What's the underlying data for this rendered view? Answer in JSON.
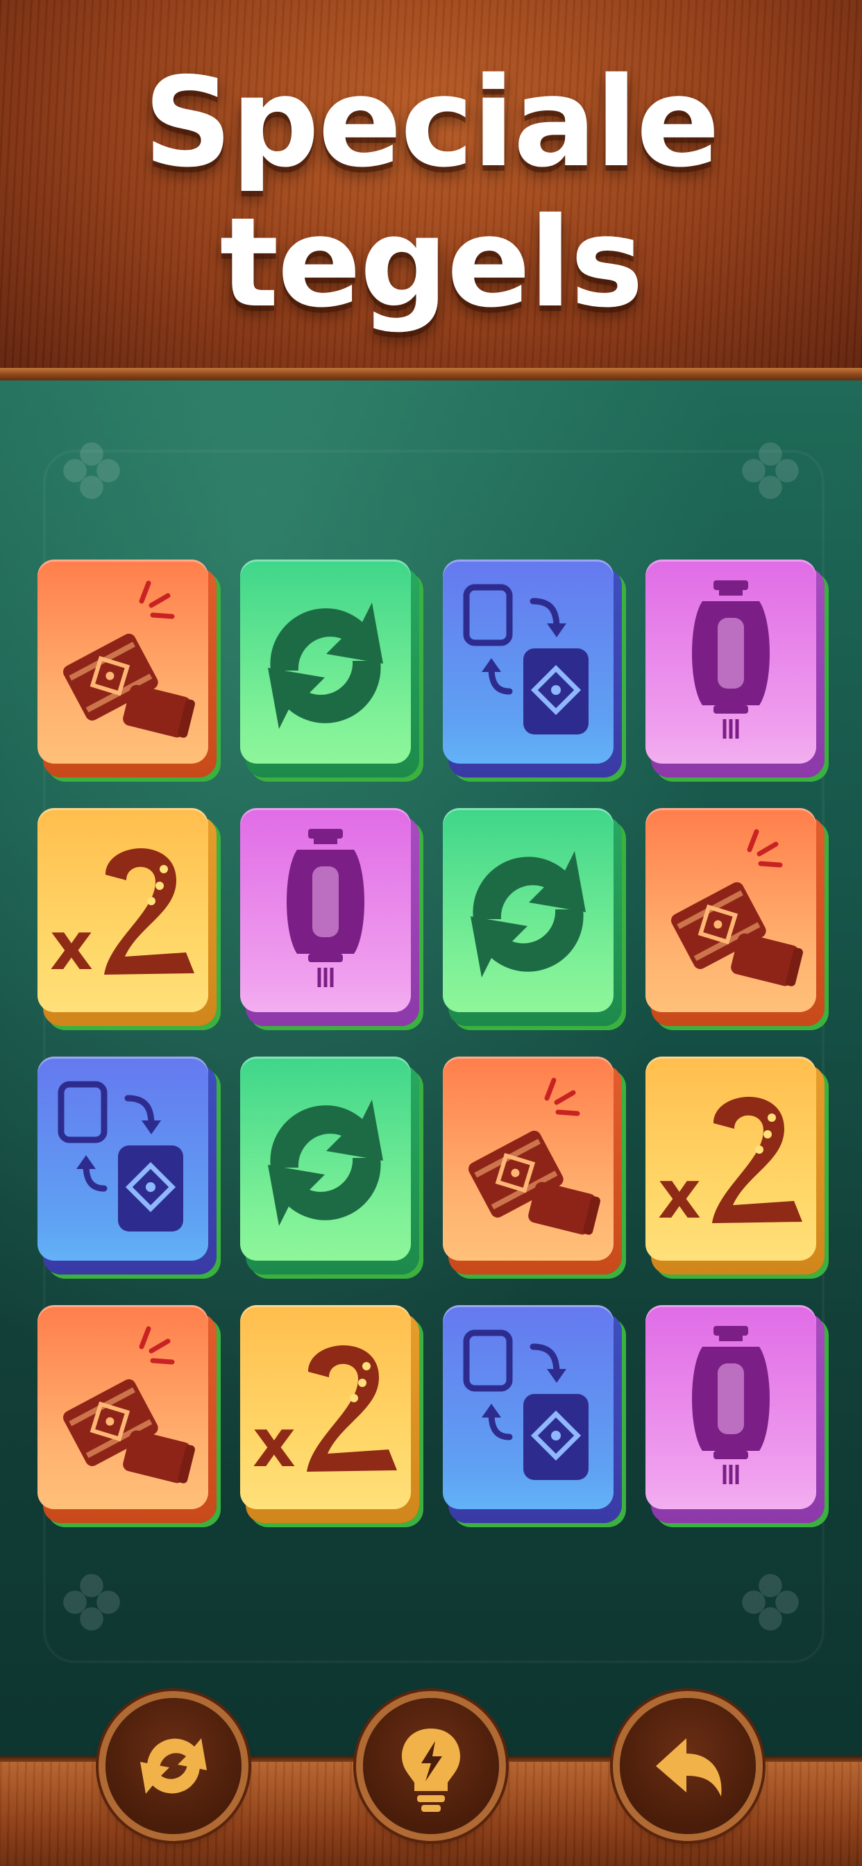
{
  "header": {
    "title_line1": "Speciale",
    "title_line2": "tegels"
  },
  "board": {
    "rows": [
      [
        "firecracker",
        "shuffle",
        "swap",
        "lantern"
      ],
      [
        "x2",
        "lantern",
        "shuffle",
        "firecracker"
      ],
      [
        "swap",
        "shuffle",
        "firecracker",
        "x2"
      ],
      [
        "firecracker",
        "x2",
        "swap",
        "lantern"
      ]
    ],
    "tile_colors": {
      "firecracker": "#ff9a5e",
      "shuffle": "#5ee58f",
      "swap": "#6b8df2",
      "lantern": "#e98ae9",
      "x2": "#ffcf5e"
    },
    "x2_label": "x2"
  },
  "toolbar": {
    "shuffle_icon": "shuffle-icon",
    "hint_icon": "lightbulb-icon",
    "undo_icon": "undo-icon"
  }
}
